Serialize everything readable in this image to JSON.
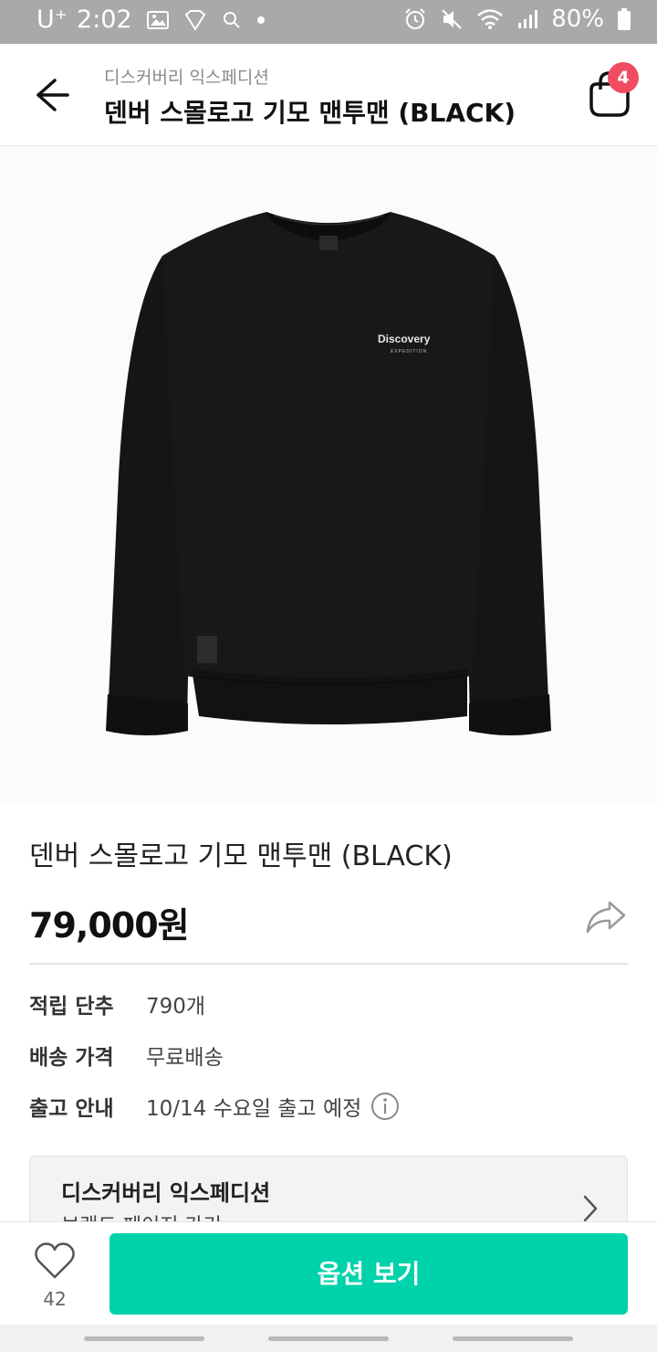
{
  "status_bar": {
    "carrier": "U⁺",
    "time": "2:02",
    "battery": "80%",
    "icons": [
      "gallery-icon",
      "badge-icon",
      "search-icon",
      "dot-icon",
      "alarm-icon",
      "mute-icon",
      "wifi-icon",
      "signal-icon",
      "battery-icon"
    ]
  },
  "header": {
    "brand": "디스커버리 익스페디션",
    "title": "덴버 스몰로고 기모 맨투맨 (BLACK)",
    "cart_count": "4",
    "icons": [
      "back-arrow-icon",
      "shopping-bag-icon"
    ]
  },
  "product": {
    "name": "덴버 스몰로고 기모 맨투맨 (BLACK)",
    "price": "79,000원",
    "image_logo": "Discovery",
    "image_logo_sub": "EXPEDITION",
    "garment_color": "#141414"
  },
  "info": {
    "rows": [
      {
        "label": "적립 단추",
        "value": "790개"
      },
      {
        "label": "배송 가격",
        "value": "무료배송"
      },
      {
        "label": "출고 안내",
        "value": "10/14 수요일 출고 예정"
      }
    ]
  },
  "brand_card": {
    "name": "디스커버리 익스페디션",
    "link": "브랜드 페이지 가기"
  },
  "bottom_bar": {
    "like_count": "42",
    "option_button": "옵션 보기"
  },
  "colors": {
    "accent": "#00d2a9",
    "badge": "#f24c63",
    "status_bar": "#a9a9a9"
  }
}
